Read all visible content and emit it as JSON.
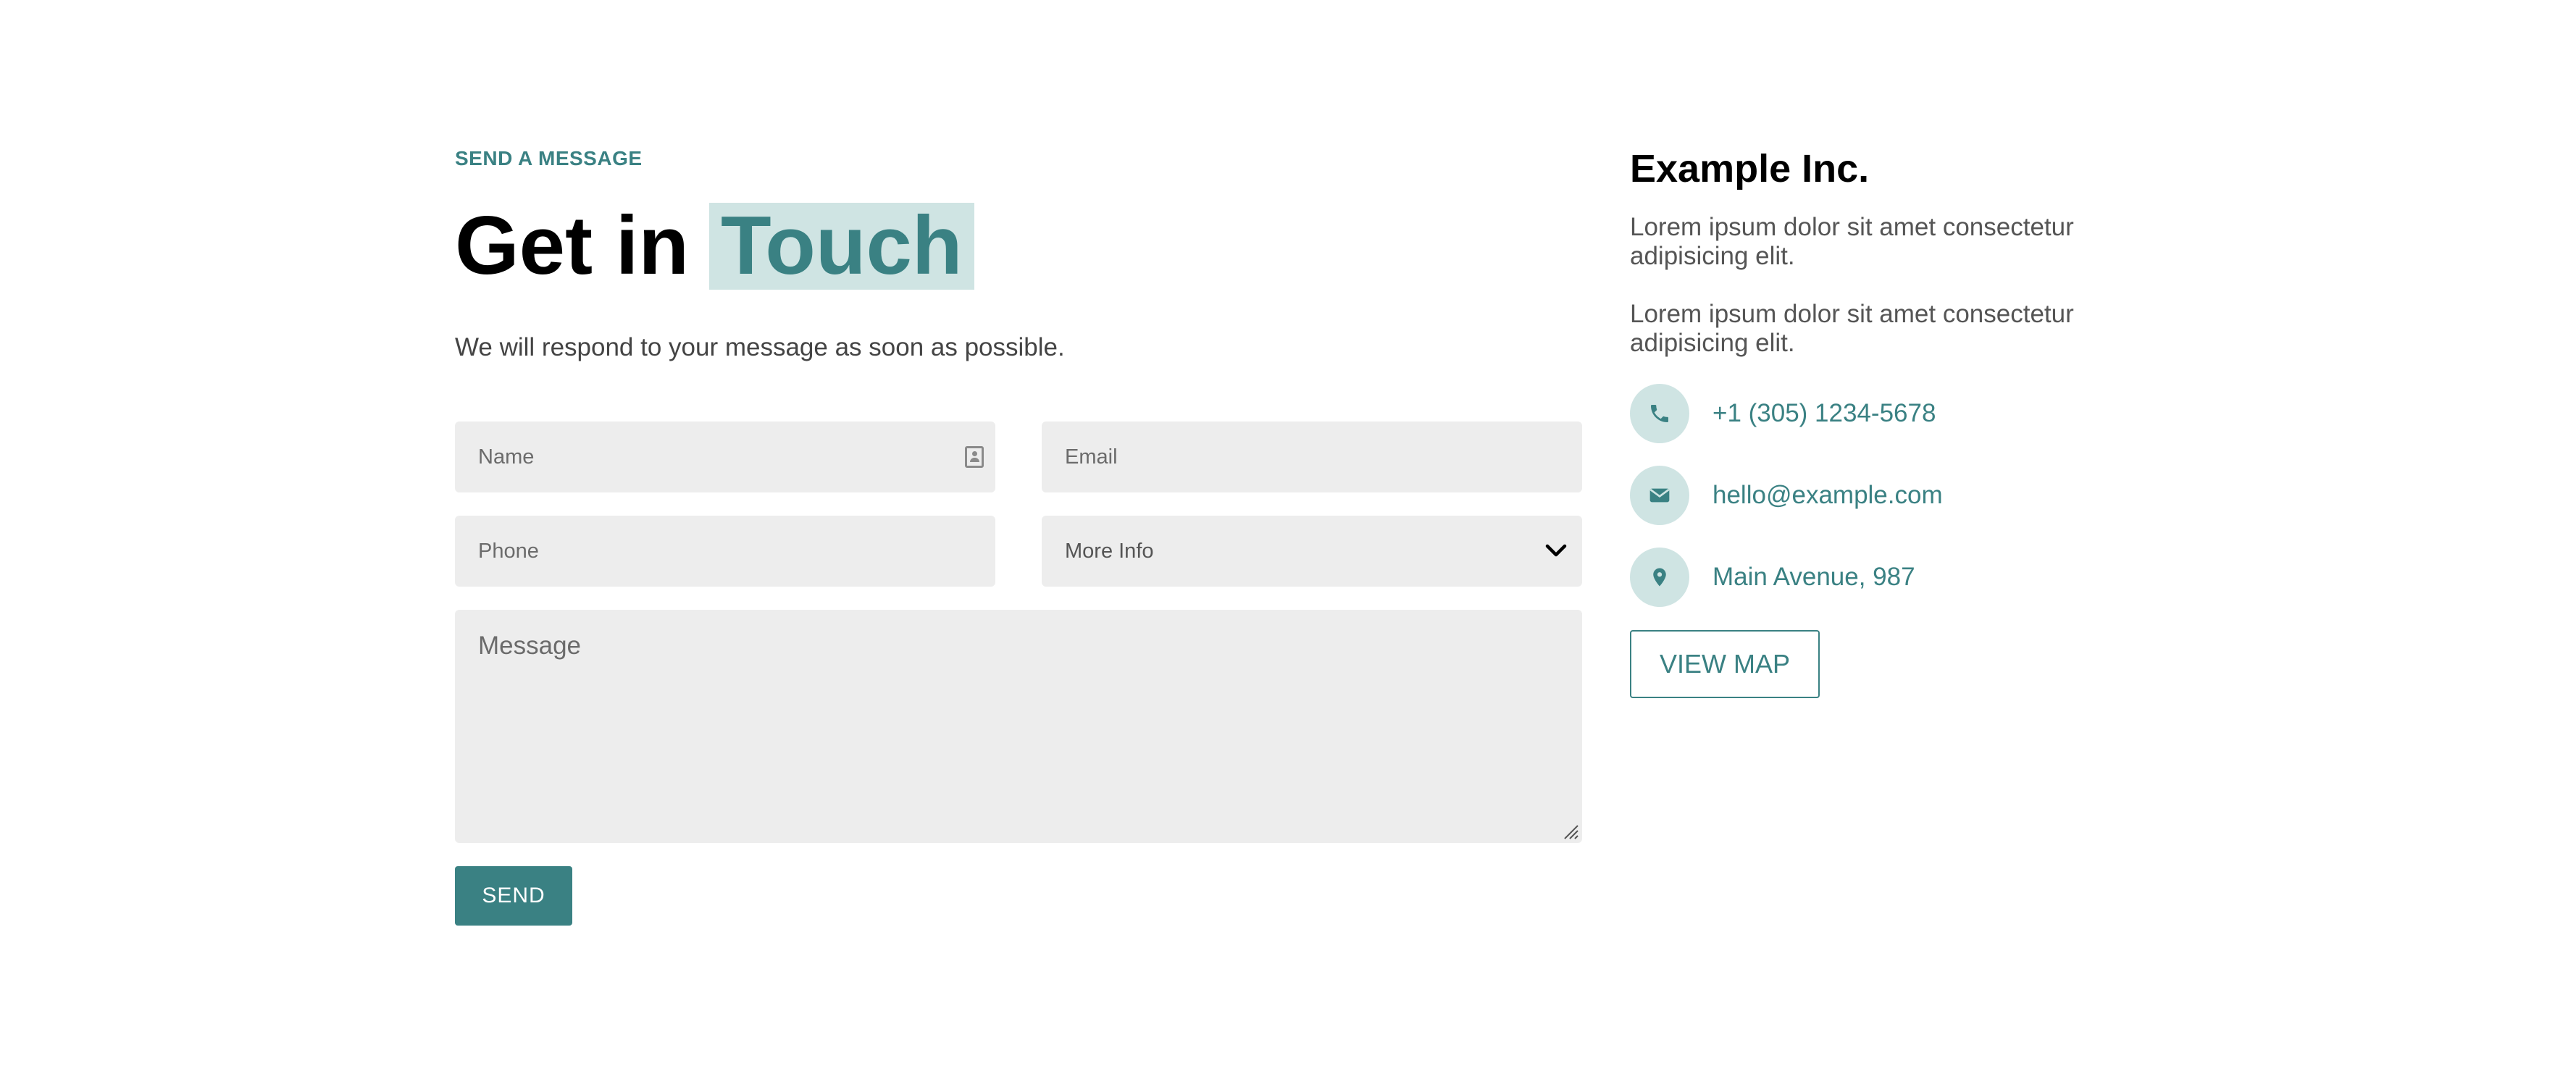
{
  "section": {
    "eyebrow": "SEND A MESSAGE",
    "title_plain": "Get in",
    "title_highlight": "Touch",
    "subtitle": "We will respond to your message as soon as possible."
  },
  "form": {
    "name_placeholder": "Name",
    "email_placeholder": "Email",
    "phone_placeholder": "Phone",
    "more_info_value": "More Info",
    "message_placeholder": "Message",
    "send_label": "SEND"
  },
  "company": {
    "name": "Example Inc.",
    "paragraphs": [
      "Lorem ipsum dolor sit amet consectetur adipisicing elit.",
      "Lorem ipsum dolor sit amet consectetur adipisicing elit."
    ],
    "contacts": [
      {
        "icon": "phone-icon",
        "text": "+1 (305) 1234-5678"
      },
      {
        "icon": "envelope-icon",
        "text": "hello@example.com"
      },
      {
        "icon": "map-pin-icon",
        "text": "Main Avenue, 987"
      }
    ],
    "view_map_label": "VIEW MAP"
  },
  "colors": {
    "accent": "#3a8183",
    "accent_light": "#cfe4e3",
    "field_bg": "#ededed"
  }
}
